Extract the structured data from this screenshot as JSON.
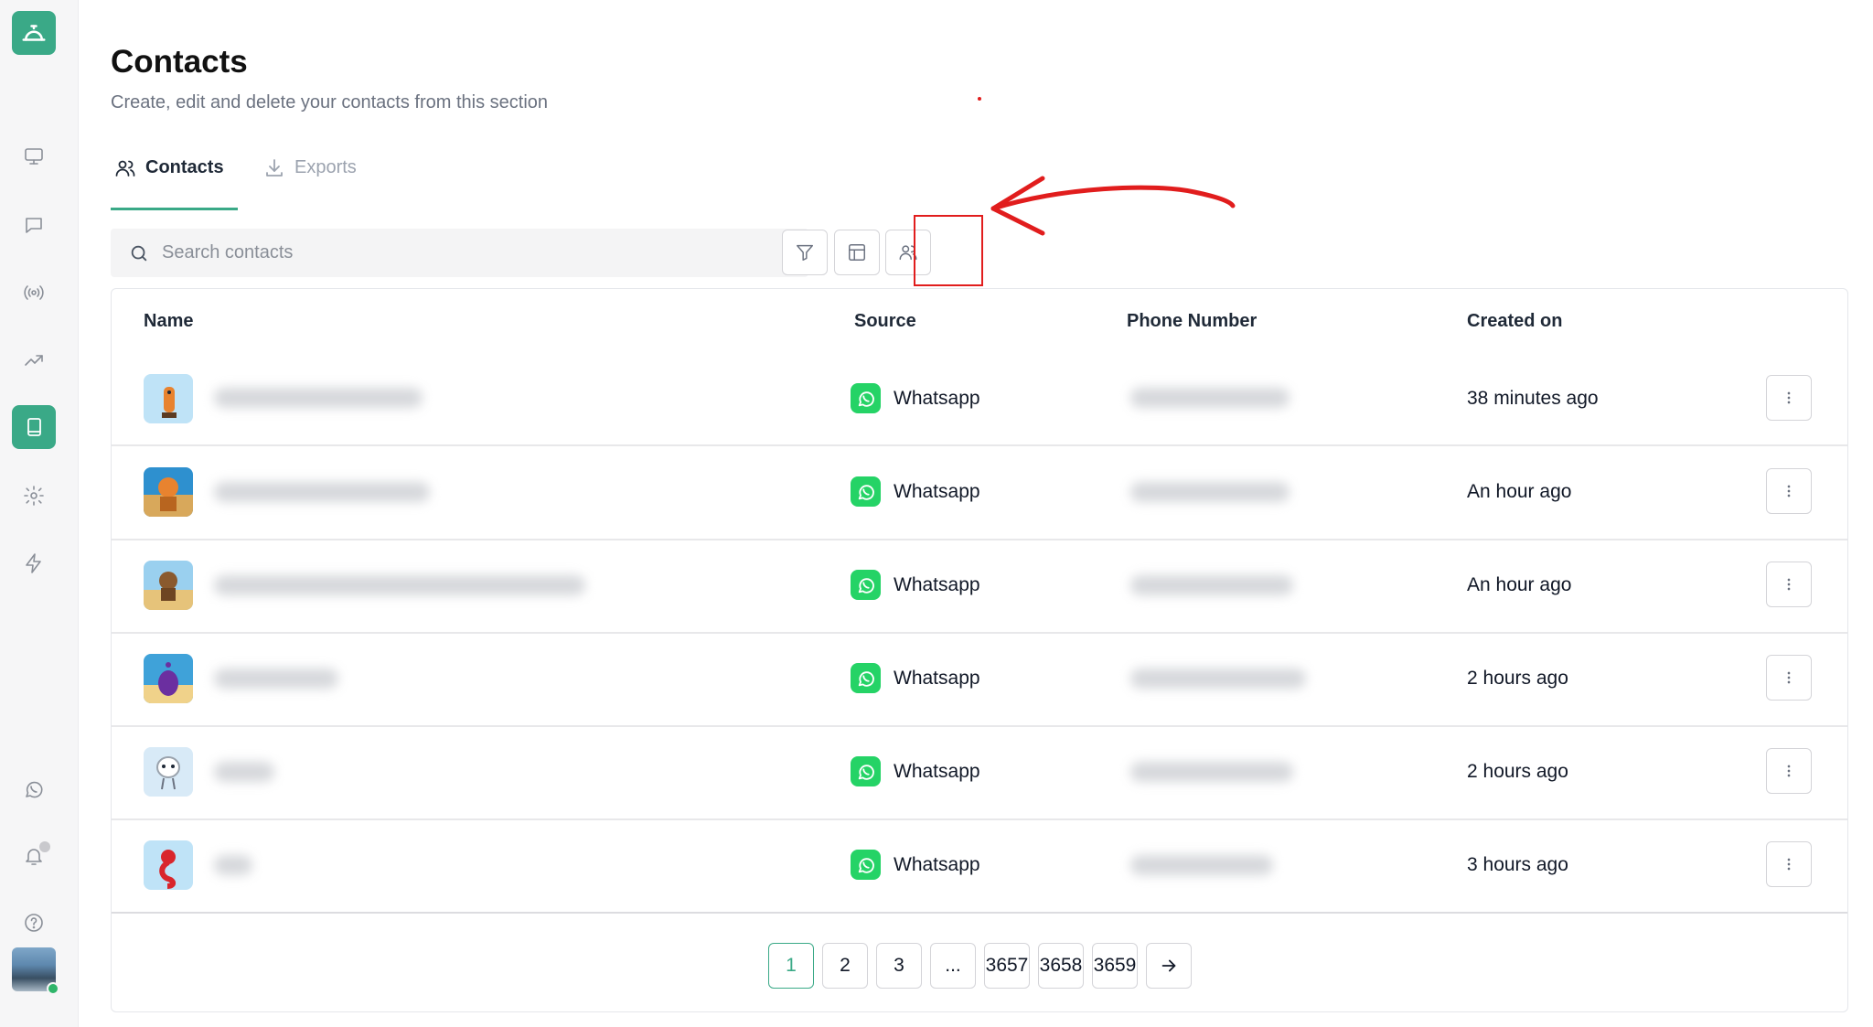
{
  "sidebar": {
    "logo_icon": "concierge-bell-icon",
    "nav_items": [
      {
        "name": "monitor",
        "icon": "monitor-icon"
      },
      {
        "name": "chat",
        "icon": "chat-bubble-icon"
      },
      {
        "name": "broadcast",
        "icon": "broadcast-icon"
      },
      {
        "name": "analytics",
        "icon": "trending-up-icon"
      },
      {
        "name": "contacts",
        "icon": "book-icon",
        "active": true
      },
      {
        "name": "settings",
        "icon": "gear-icon"
      },
      {
        "name": "automation",
        "icon": "lightning-icon"
      },
      {
        "name": "whatsapp",
        "icon": "whatsapp-icon"
      },
      {
        "name": "notifications",
        "icon": "bell-icon"
      },
      {
        "name": "help",
        "icon": "help-circle-icon"
      }
    ],
    "accent_color": "#3aa987"
  },
  "header": {
    "title": "Contacts",
    "subtitle": "Create, edit and delete your contacts from this section"
  },
  "tabs": [
    {
      "label": "Contacts",
      "icon": "users-icon",
      "active": true
    },
    {
      "label": "Exports",
      "icon": "download-icon",
      "active": false
    }
  ],
  "toolbar": {
    "search_placeholder": "Search contacts",
    "filter_icon": "filter-icon",
    "columns_icon": "table-layout-icon",
    "audience_icon": "users-icon"
  },
  "table": {
    "columns": [
      "Name",
      "Source",
      "Phone Number",
      "Created on"
    ],
    "rows": [
      {
        "source": "Whatsapp",
        "created": "38 minutes ago"
      },
      {
        "source": "Whatsapp",
        "created": "An hour ago"
      },
      {
        "source": "Whatsapp",
        "created": "An hour ago"
      },
      {
        "source": "Whatsapp",
        "created": "2 hours ago"
      },
      {
        "source": "Whatsapp",
        "created": "2 hours ago"
      },
      {
        "source": "Whatsapp",
        "created": "3 hours ago"
      }
    ]
  },
  "pagination": {
    "pages": [
      "1",
      "2",
      "3",
      "...",
      "3657",
      "3658",
      "3659"
    ],
    "current": "1",
    "next_icon": "arrow-right-icon"
  },
  "annotation_color": "#e11d1d"
}
